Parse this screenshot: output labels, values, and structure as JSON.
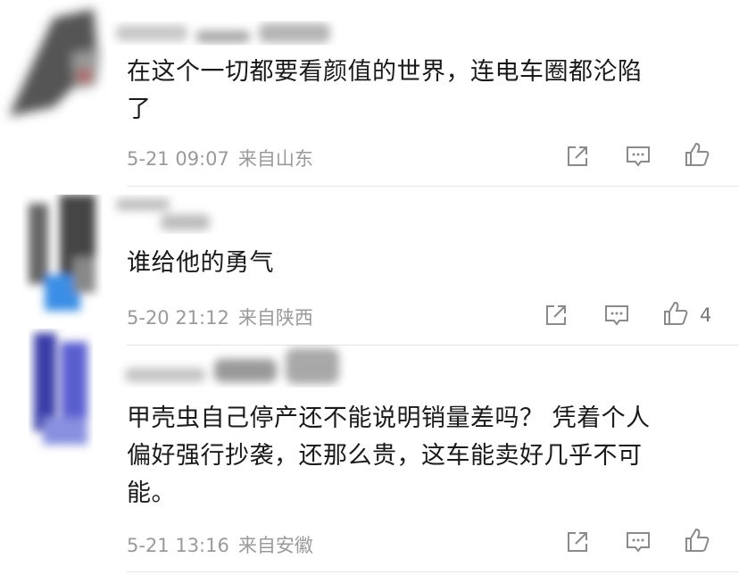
{
  "comments": [
    {
      "text_lines": [
        "在这个一切都要看颜值的世界，连电车圈都沦陷",
        "了"
      ],
      "date": "5-21 09:07",
      "location": "来自山东",
      "like_count": ""
    },
    {
      "text_lines": [
        "谁给他的勇气"
      ],
      "date": "5-20 21:12",
      "location": "来自陕西",
      "like_count": "4"
    },
    {
      "text_lines": [
        "甲壳虫自己停产还不能说明销量差吗？ 凭着个人",
        "偏好强行抄袭，还那么贵，这车能卖好几乎不可",
        "能。"
      ],
      "date": "5-21 13:16",
      "location": "来自安徽",
      "like_count": ""
    }
  ],
  "icons": {
    "share": "share-icon",
    "comment": "comment-icon",
    "like": "thumbs-up-icon"
  },
  "colors": {
    "text": "#1a1a1a",
    "meta": "#9a9a9a",
    "icon": "#8a8a8a",
    "divider": "#e6e6e6"
  }
}
